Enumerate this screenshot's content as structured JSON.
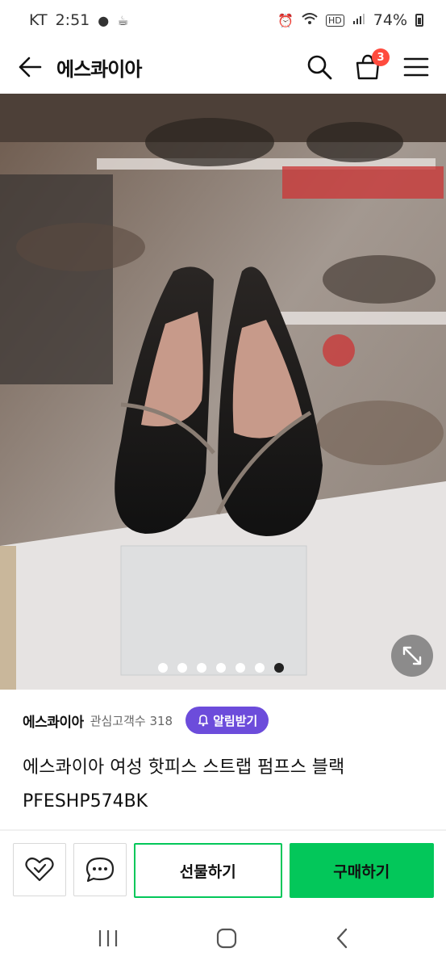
{
  "status": {
    "carrier": "KT",
    "time": "2:51",
    "battery": "74%"
  },
  "appbar": {
    "title": "에스콰이아",
    "cart_count": "3"
  },
  "gallery": {
    "slide_count": 7,
    "active_index": 6
  },
  "store": {
    "name": "에스콰이아",
    "followers": "관심고객수 318",
    "alarm_label": "알림받기"
  },
  "product": {
    "title": "에스콰이아 여성 핫피스 스트랩 펌프스 블랙 PFESHP574BK"
  },
  "actions": {
    "gift_label": "선물하기",
    "buy_label": "구매하기"
  },
  "colors": {
    "accent_green": "#03c75a",
    "alarm_purple": "#6c4cdb",
    "badge_red": "#ff4b3e"
  }
}
